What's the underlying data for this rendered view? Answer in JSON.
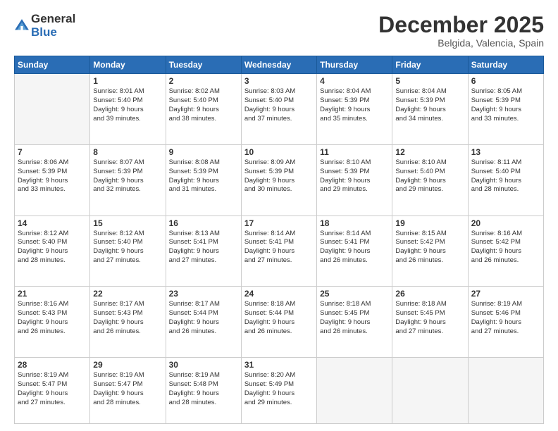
{
  "logo": {
    "general": "General",
    "blue": "Blue"
  },
  "title": "December 2025",
  "location": "Belgida, Valencia, Spain",
  "days_of_week": [
    "Sunday",
    "Monday",
    "Tuesday",
    "Wednesday",
    "Thursday",
    "Friday",
    "Saturday"
  ],
  "weeks": [
    [
      {
        "day": "",
        "info": ""
      },
      {
        "day": "1",
        "info": "Sunrise: 8:01 AM\nSunset: 5:40 PM\nDaylight: 9 hours\nand 39 minutes."
      },
      {
        "day": "2",
        "info": "Sunrise: 8:02 AM\nSunset: 5:40 PM\nDaylight: 9 hours\nand 38 minutes."
      },
      {
        "day": "3",
        "info": "Sunrise: 8:03 AM\nSunset: 5:40 PM\nDaylight: 9 hours\nand 37 minutes."
      },
      {
        "day": "4",
        "info": "Sunrise: 8:04 AM\nSunset: 5:39 PM\nDaylight: 9 hours\nand 35 minutes."
      },
      {
        "day": "5",
        "info": "Sunrise: 8:04 AM\nSunset: 5:39 PM\nDaylight: 9 hours\nand 34 minutes."
      },
      {
        "day": "6",
        "info": "Sunrise: 8:05 AM\nSunset: 5:39 PM\nDaylight: 9 hours\nand 33 minutes."
      }
    ],
    [
      {
        "day": "7",
        "info": "Sunrise: 8:06 AM\nSunset: 5:39 PM\nDaylight: 9 hours\nand 33 minutes."
      },
      {
        "day": "8",
        "info": "Sunrise: 8:07 AM\nSunset: 5:39 PM\nDaylight: 9 hours\nand 32 minutes."
      },
      {
        "day": "9",
        "info": "Sunrise: 8:08 AM\nSunset: 5:39 PM\nDaylight: 9 hours\nand 31 minutes."
      },
      {
        "day": "10",
        "info": "Sunrise: 8:09 AM\nSunset: 5:39 PM\nDaylight: 9 hours\nand 30 minutes."
      },
      {
        "day": "11",
        "info": "Sunrise: 8:10 AM\nSunset: 5:39 PM\nDaylight: 9 hours\nand 29 minutes."
      },
      {
        "day": "12",
        "info": "Sunrise: 8:10 AM\nSunset: 5:40 PM\nDaylight: 9 hours\nand 29 minutes."
      },
      {
        "day": "13",
        "info": "Sunrise: 8:11 AM\nSunset: 5:40 PM\nDaylight: 9 hours\nand 28 minutes."
      }
    ],
    [
      {
        "day": "14",
        "info": "Sunrise: 8:12 AM\nSunset: 5:40 PM\nDaylight: 9 hours\nand 28 minutes."
      },
      {
        "day": "15",
        "info": "Sunrise: 8:12 AM\nSunset: 5:40 PM\nDaylight: 9 hours\nand 27 minutes."
      },
      {
        "day": "16",
        "info": "Sunrise: 8:13 AM\nSunset: 5:41 PM\nDaylight: 9 hours\nand 27 minutes."
      },
      {
        "day": "17",
        "info": "Sunrise: 8:14 AM\nSunset: 5:41 PM\nDaylight: 9 hours\nand 27 minutes."
      },
      {
        "day": "18",
        "info": "Sunrise: 8:14 AM\nSunset: 5:41 PM\nDaylight: 9 hours\nand 26 minutes."
      },
      {
        "day": "19",
        "info": "Sunrise: 8:15 AM\nSunset: 5:42 PM\nDaylight: 9 hours\nand 26 minutes."
      },
      {
        "day": "20",
        "info": "Sunrise: 8:16 AM\nSunset: 5:42 PM\nDaylight: 9 hours\nand 26 minutes."
      }
    ],
    [
      {
        "day": "21",
        "info": "Sunrise: 8:16 AM\nSunset: 5:43 PM\nDaylight: 9 hours\nand 26 minutes."
      },
      {
        "day": "22",
        "info": "Sunrise: 8:17 AM\nSunset: 5:43 PM\nDaylight: 9 hours\nand 26 minutes."
      },
      {
        "day": "23",
        "info": "Sunrise: 8:17 AM\nSunset: 5:44 PM\nDaylight: 9 hours\nand 26 minutes."
      },
      {
        "day": "24",
        "info": "Sunrise: 8:18 AM\nSunset: 5:44 PM\nDaylight: 9 hours\nand 26 minutes."
      },
      {
        "day": "25",
        "info": "Sunrise: 8:18 AM\nSunset: 5:45 PM\nDaylight: 9 hours\nand 26 minutes."
      },
      {
        "day": "26",
        "info": "Sunrise: 8:18 AM\nSunset: 5:45 PM\nDaylight: 9 hours\nand 27 minutes."
      },
      {
        "day": "27",
        "info": "Sunrise: 8:19 AM\nSunset: 5:46 PM\nDaylight: 9 hours\nand 27 minutes."
      }
    ],
    [
      {
        "day": "28",
        "info": "Sunrise: 8:19 AM\nSunset: 5:47 PM\nDaylight: 9 hours\nand 27 minutes."
      },
      {
        "day": "29",
        "info": "Sunrise: 8:19 AM\nSunset: 5:47 PM\nDaylight: 9 hours\nand 28 minutes."
      },
      {
        "day": "30",
        "info": "Sunrise: 8:19 AM\nSunset: 5:48 PM\nDaylight: 9 hours\nand 28 minutes."
      },
      {
        "day": "31",
        "info": "Sunrise: 8:20 AM\nSunset: 5:49 PM\nDaylight: 9 hours\nand 29 minutes."
      },
      {
        "day": "",
        "info": ""
      },
      {
        "day": "",
        "info": ""
      },
      {
        "day": "",
        "info": ""
      }
    ]
  ]
}
